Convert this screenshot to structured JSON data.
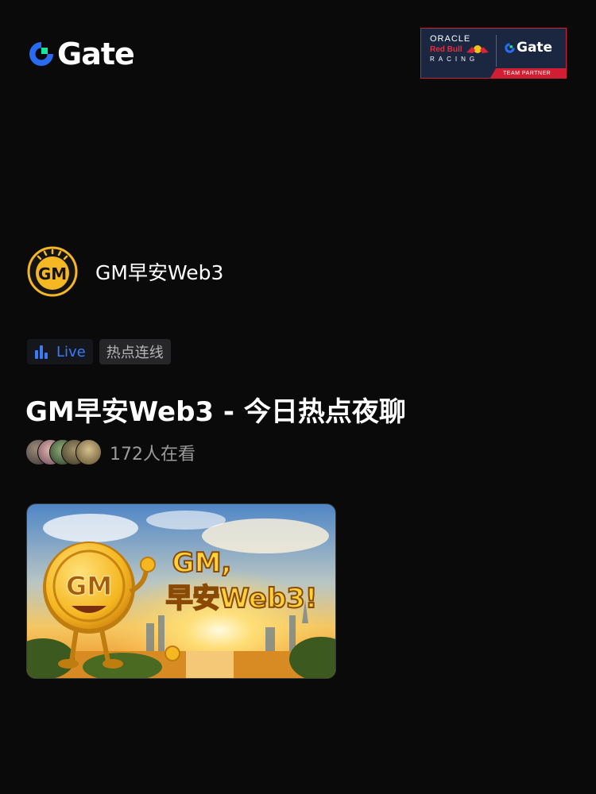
{
  "header": {
    "logo_text": "Gate",
    "logo_icon": "gate-logo-icon",
    "partner": {
      "oracle": "ORACLE",
      "redbull": "Red Bull",
      "racing": "RACING",
      "gate": "Gate",
      "band": "TEAM PARTNER"
    }
  },
  "channel": {
    "avatar_text": "GM",
    "name": "GM早安Web3"
  },
  "tags": {
    "live_label": "Live",
    "topic_label": "热点连线"
  },
  "stream": {
    "title": "GM早安Web3 - 今日热点夜聊",
    "viewers_text": "172人在看"
  },
  "cover": {
    "coin_text": "GM",
    "headline_line1": "GM,",
    "headline_line2": "早安Web3!"
  },
  "colors": {
    "background": "#0a0a0a",
    "accent_blue": "#3b7cf6",
    "gate_green": "#17e5a0",
    "coin_gold": "#f5b722",
    "partner_red": "#d21e33",
    "partner_navy": "#1b2640"
  }
}
